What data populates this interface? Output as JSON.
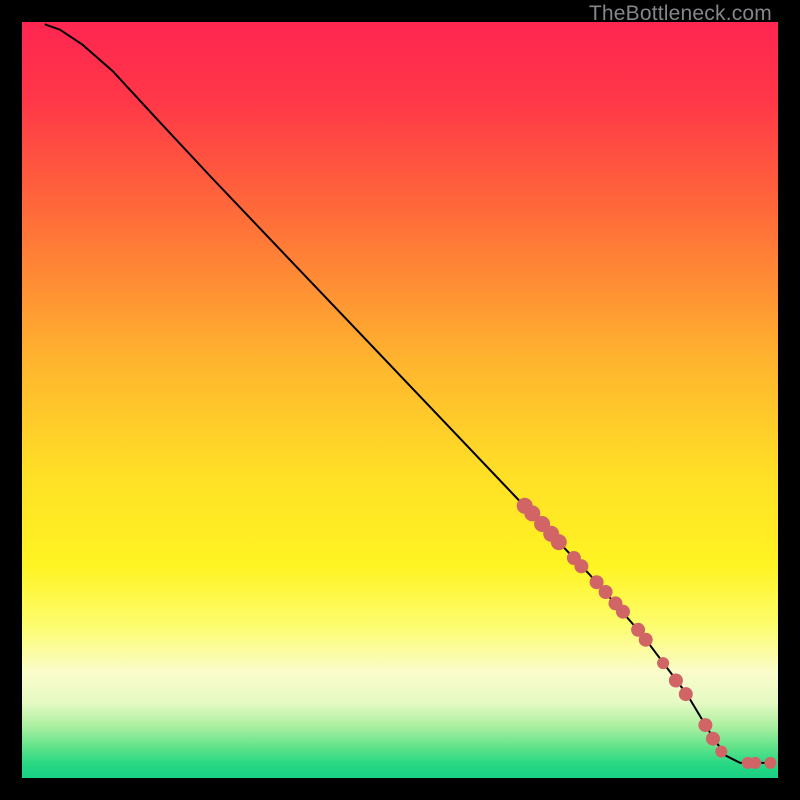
{
  "watermark": "TheBottleneck.com",
  "chart_data": {
    "type": "line",
    "title": "",
    "xlabel": "",
    "ylabel": "",
    "xlim": [
      0,
      100
    ],
    "ylim": [
      0,
      100
    ],
    "background_gradient_stops": [
      {
        "pct": 0,
        "color": "#ff2651"
      },
      {
        "pct": 10,
        "color": "#ff3648"
      },
      {
        "pct": 25,
        "color": "#ff6a3a"
      },
      {
        "pct": 45,
        "color": "#ffb52e"
      },
      {
        "pct": 60,
        "color": "#ffe026"
      },
      {
        "pct": 72,
        "color": "#fff423"
      },
      {
        "pct": 80,
        "color": "#fdfd70"
      },
      {
        "pct": 86,
        "color": "#fafccc"
      },
      {
        "pct": 90,
        "color": "#e6fac4"
      },
      {
        "pct": 93,
        "color": "#aef0a2"
      },
      {
        "pct": 96,
        "color": "#5fe28a"
      },
      {
        "pct": 98,
        "color": "#2bd884"
      },
      {
        "pct": 100,
        "color": "#16d183"
      }
    ],
    "series": [
      {
        "name": "curve",
        "stroke": "#000000",
        "points": [
          {
            "x": 3.0,
            "y": 99.7
          },
          {
            "x": 5.0,
            "y": 99.0
          },
          {
            "x": 8.0,
            "y": 97.0
          },
          {
            "x": 12.0,
            "y": 93.5
          },
          {
            "x": 18.0,
            "y": 87.0
          },
          {
            "x": 25.0,
            "y": 79.5
          },
          {
            "x": 35.0,
            "y": 69.0
          },
          {
            "x": 45.0,
            "y": 58.5
          },
          {
            "x": 55.0,
            "y": 48.0
          },
          {
            "x": 65.0,
            "y": 37.5
          },
          {
            "x": 75.0,
            "y": 27.0
          },
          {
            "x": 82.0,
            "y": 19.0
          },
          {
            "x": 88.0,
            "y": 11.0
          },
          {
            "x": 91.0,
            "y": 6.0
          },
          {
            "x": 93.0,
            "y": 3.0
          },
          {
            "x": 95.0,
            "y": 2.0
          },
          {
            "x": 98.0,
            "y": 2.0
          },
          {
            "x": 99.0,
            "y": 2.0
          }
        ]
      }
    ],
    "markers": {
      "fill": "#d16566",
      "r_major": 8,
      "r_minor": 6,
      "points": [
        {
          "x": 66.5,
          "y": 36.0,
          "r": 8
        },
        {
          "x": 67.5,
          "y": 35.0,
          "r": 8
        },
        {
          "x": 68.8,
          "y": 33.6,
          "r": 8
        },
        {
          "x": 70.0,
          "y": 32.3,
          "r": 8
        },
        {
          "x": 71.0,
          "y": 31.2,
          "r": 8
        },
        {
          "x": 73.0,
          "y": 29.1,
          "r": 7
        },
        {
          "x": 74.0,
          "y": 28.0,
          "r": 7
        },
        {
          "x": 76.0,
          "y": 25.9,
          "r": 7
        },
        {
          "x": 77.2,
          "y": 24.6,
          "r": 7
        },
        {
          "x": 78.5,
          "y": 23.1,
          "r": 7
        },
        {
          "x": 79.5,
          "y": 22.0,
          "r": 7
        },
        {
          "x": 81.5,
          "y": 19.6,
          "r": 7
        },
        {
          "x": 82.5,
          "y": 18.3,
          "r": 7
        },
        {
          "x": 84.8,
          "y": 15.2,
          "r": 6
        },
        {
          "x": 86.5,
          "y": 12.9,
          "r": 7
        },
        {
          "x": 87.8,
          "y": 11.1,
          "r": 7
        },
        {
          "x": 90.4,
          "y": 7.0,
          "r": 7
        },
        {
          "x": 91.4,
          "y": 5.2,
          "r": 7
        },
        {
          "x": 92.5,
          "y": 3.5,
          "r": 6
        },
        {
          "x": 96.0,
          "y": 2.0,
          "r": 6
        },
        {
          "x": 97.0,
          "y": 2.0,
          "r": 6
        },
        {
          "x": 99.0,
          "y": 2.0,
          "r": 6
        }
      ]
    }
  }
}
